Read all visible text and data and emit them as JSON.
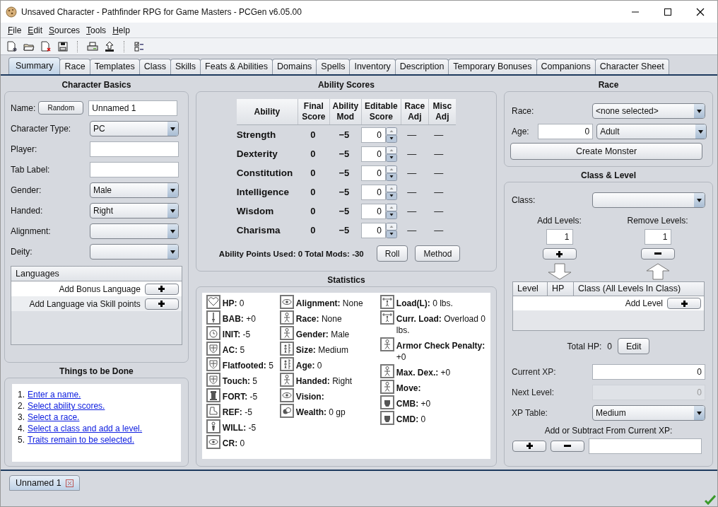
{
  "window": {
    "title": "Unsaved Character - Pathfinder RPG for Game Masters - PCGen v6.05.00"
  },
  "menu": [
    "File",
    "Edit",
    "Sources",
    "Tools",
    "Help"
  ],
  "tabs": [
    {
      "label": "Summary",
      "selected": true
    },
    {
      "label": "Race",
      "selected": false
    },
    {
      "label": "Templates",
      "selected": false
    },
    {
      "label": "Class",
      "selected": false
    },
    {
      "label": "Skills",
      "selected": false
    },
    {
      "label": "Feats & Abilities",
      "selected": false
    },
    {
      "label": "Domains",
      "selected": false
    },
    {
      "label": "Spells",
      "selected": false
    },
    {
      "label": "Inventory",
      "selected": false
    },
    {
      "label": "Description",
      "selected": false
    },
    {
      "label": "Temporary Bonuses",
      "selected": false
    },
    {
      "label": "Companions",
      "selected": false
    },
    {
      "label": "Character Sheet",
      "selected": false
    }
  ],
  "character_basics": {
    "title": "Character Basics",
    "name_label": "Name:",
    "random_button": "Random",
    "name_value": "Unnamed 1",
    "fields": [
      {
        "label": "Character Type:",
        "kind": "select",
        "value": "PC"
      },
      {
        "label": "Player:",
        "kind": "text"
      },
      {
        "label": "Tab Label:",
        "kind": "text"
      },
      {
        "label": "Gender:",
        "kind": "select",
        "value": "Male"
      },
      {
        "label": "Handed:",
        "kind": "select",
        "value": "Right"
      },
      {
        "label": "Alignment:",
        "kind": "select"
      },
      {
        "label": "Deity:",
        "kind": "select"
      }
    ],
    "languages": {
      "title": "Languages",
      "rows": [
        {
          "label": "Add Bonus Language"
        },
        {
          "label": "Add Language via Skill points"
        }
      ]
    }
  },
  "things_to_be_done": {
    "title": "Things to be Done",
    "items": [
      {
        "number": "1.",
        "text": "Enter a name."
      },
      {
        "number": "2.",
        "text": "Select ability scores."
      },
      {
        "number": "3.",
        "text": "Select a race."
      },
      {
        "number": "4.",
        "text": "Select a class and add a level."
      },
      {
        "number": "5.",
        "text": "Traits remain to be selected."
      }
    ]
  },
  "ability_scores": {
    "title": "Ability Scores",
    "columns": [
      "Ability",
      "Final Score",
      "Ability Mod",
      "Editable Score",
      "Race Adj",
      "Misc Adj"
    ],
    "rows": [
      {
        "ability": "Strength",
        "final": "0",
        "mod": "−5",
        "editable": "0",
        "race_adj": "—",
        "misc_adj": "—"
      },
      {
        "ability": "Dexterity",
        "final": "0",
        "mod": "−5",
        "editable": "0",
        "race_adj": "—",
        "misc_adj": "—"
      },
      {
        "ability": "Constitution",
        "final": "0",
        "mod": "−5",
        "editable": "0",
        "race_adj": "—",
        "misc_adj": "—"
      },
      {
        "ability": "Intelligence",
        "final": "0",
        "mod": "−5",
        "editable": "0",
        "race_adj": "—",
        "misc_adj": "—"
      },
      {
        "ability": "Wisdom",
        "final": "0",
        "mod": "−5",
        "editable": "0",
        "race_adj": "—",
        "misc_adj": "—"
      },
      {
        "ability": "Charisma",
        "final": "0",
        "mod": "−5",
        "editable": "0",
        "race_adj": "—",
        "misc_adj": "—"
      }
    ],
    "footer": "Ability Points Used: 0 Total Mods: -30",
    "buttons": [
      "Roll",
      "Method"
    ]
  },
  "statistics": {
    "title": "Statistics",
    "columns": [
      [
        "**HP:** 0",
        "**BAB:** +0",
        "**INIT:** -5",
        "**AC:** 5",
        "**Flatfooted:** 5",
        "**Touch:** 5",
        "**FORT:** -5",
        "**REF:** -5",
        "**WILL:** -5",
        "**CR:** 0"
      ],
      [
        "**Alignment:** None",
        "**Race:**  None",
        "**Gender:** Male",
        "**Size:** Medium",
        "**Age:** 0",
        "**Handed:** Right",
        "**Vision:**",
        "**Wealth:** 0 gp"
      ],
      [
        "**Load(L):** 0 lbs.",
        "**Curr. Load:** Overload 0 lbs.",
        "**Armor Check Penalty:** +0",
        "**Max. Dex.:** +0",
        "**Move:**",
        "**CMB:** +0",
        "**CMD:** 0"
      ]
    ]
  },
  "race": {
    "title": "Race",
    "race_label": "Race:",
    "race_value": "<none selected>",
    "age_label": "Age:",
    "age_value": "0",
    "age_category": "Adult",
    "create_button": "Create Monster"
  },
  "class_level": {
    "title": "Class & Level",
    "class_label": "Class:",
    "add_levels_label": "Add Levels:",
    "add_levels_value": "1",
    "remove_levels_label": "Remove Levels:",
    "remove_levels_value": "1",
    "table_columns": [
      "Level",
      "HP",
      "Class (All Levels In Class)"
    ],
    "add_level_label": "Add Level",
    "total_hp_label": "Total HP:",
    "total_hp_value": "0",
    "edit_button": "Edit",
    "xp_fields": [
      {
        "label": "Current XP:",
        "kind": "text",
        "value": "0",
        "disabled": false
      },
      {
        "label": "Next Level:",
        "kind": "text",
        "value": "0",
        "disabled": true
      },
      {
        "label": "XP Table:",
        "kind": "select",
        "value": "Medium",
        "disabled": false
      }
    ],
    "adjust_label": "Add or Subtract From Current XP:"
  },
  "character_tabs": [
    {
      "label": "Unnamed 1",
      "selected": true
    }
  ]
}
